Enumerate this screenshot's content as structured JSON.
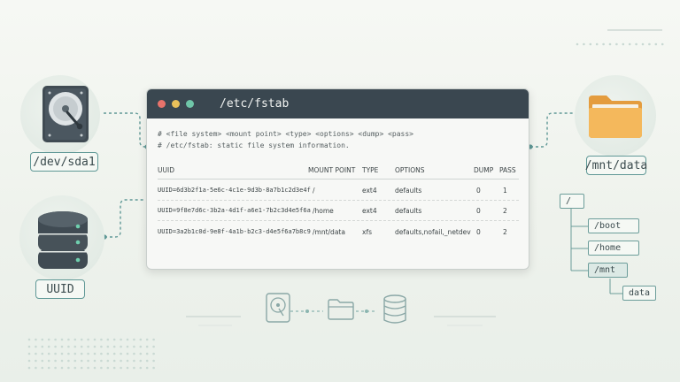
{
  "terminal": {
    "title": "/etc/fstab",
    "comment1": "# <file system> <mount point>      <type>     <options>                         <dump>  <pass>",
    "comment2": "# /etc/fstab: static file system information.",
    "headers": [
      "UUID",
      "MOUNT POINT",
      "TYPE",
      "OPTIONS",
      "DUMP",
      "PASS"
    ],
    "rows": [
      [
        "UUID=6d3b2f1a-5e6c-4c1e-9d3b-8a7b1c2d3e4f",
        "/",
        "ext4",
        "defaults",
        "0",
        "1"
      ],
      [
        "UUID=9f8e7d6c-3b2a-4d1f-a6e1-7b2c3d4e5f6a",
        "/home",
        "ext4",
        "defaults",
        "0",
        "2"
      ],
      [
        "UUID=3a2b1c0d-9e8f-4a1b-b2c3-d4e5f6a7b8c9",
        "/mnt/data",
        "xfs",
        "defaults,nofail,_netdev",
        "0",
        "2"
      ]
    ],
    "dot_colors": [
      "#e8736b",
      "#e9c15a",
      "#6fc6a8"
    ]
  },
  "labels": {
    "disk": "/dev/sda1",
    "uuid": "UUID",
    "folder": "/mnt/data"
  },
  "tree": {
    "root": "/",
    "children": [
      "/boot",
      "/home",
      "/mnt"
    ],
    "mnt_child": "data"
  },
  "icons": {
    "disk": "hard-drive-icon",
    "database": "database-icon",
    "folder": "folder-icon"
  },
  "colors": {
    "accent": "#5f9896",
    "titlebar": "#3a4750",
    "folder": "#f2b25a"
  }
}
